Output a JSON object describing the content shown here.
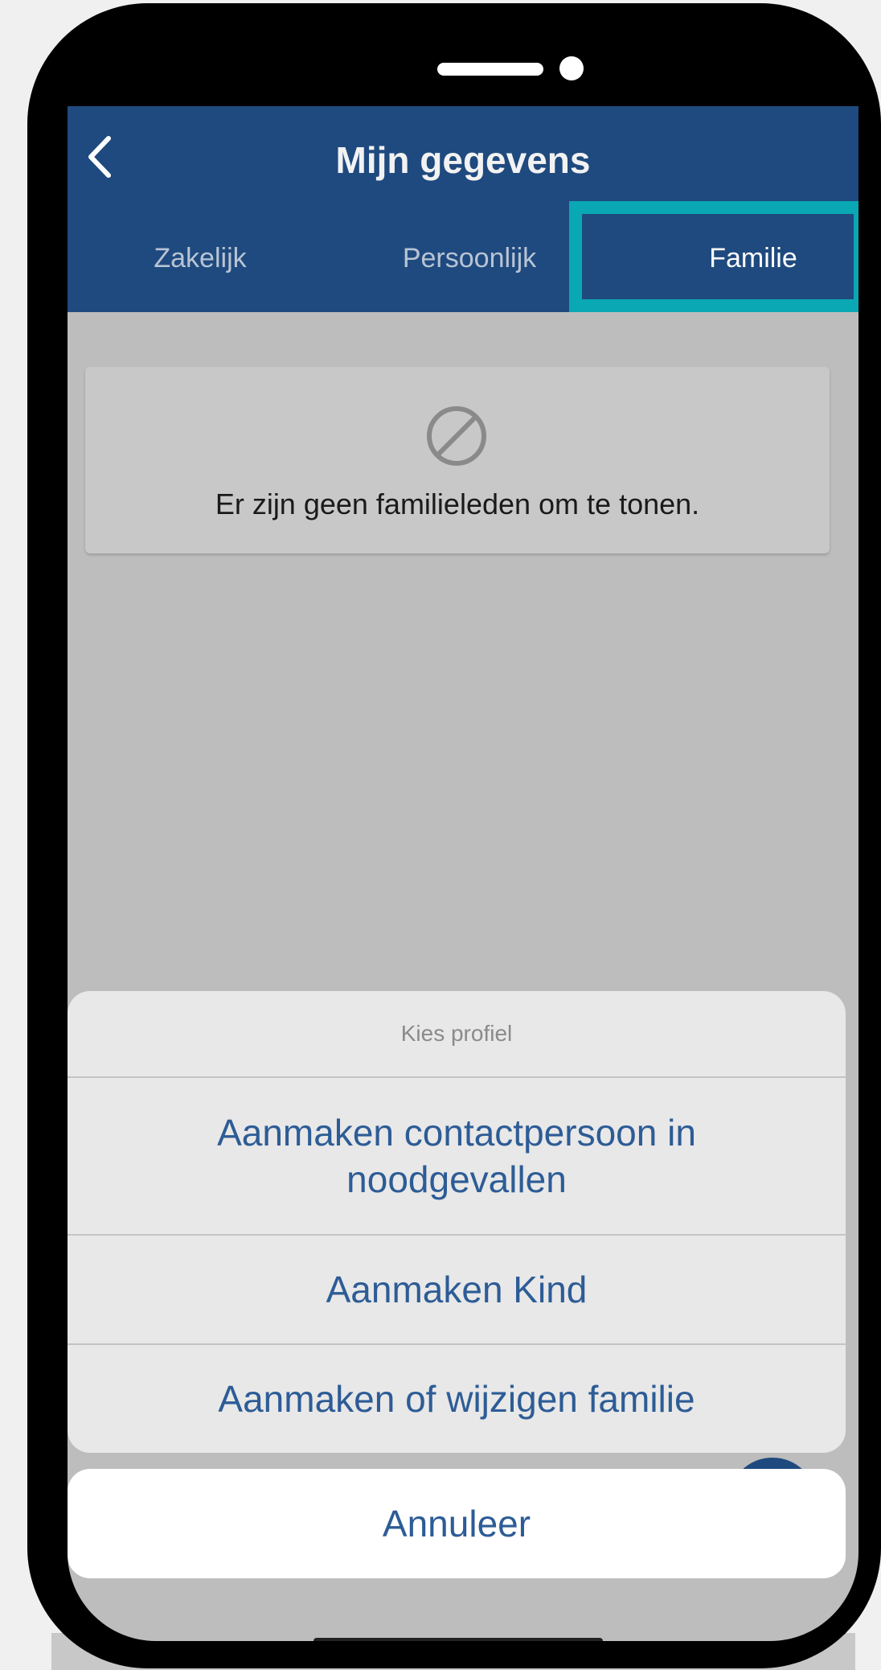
{
  "header": {
    "title": "Mijn gegevens",
    "back_icon": "chevron-left-icon"
  },
  "tabs": [
    {
      "label": "Zakelijk",
      "active": false
    },
    {
      "label": "Persoonlijk",
      "active": false
    },
    {
      "label": "Familie",
      "active": true
    }
  ],
  "highlight_color": "#0aa7b4",
  "brand_color": "#1f4a7f",
  "empty_state": {
    "icon": "ban-icon",
    "message": "Er zijn geen familieleden om te tonen."
  },
  "action_sheet": {
    "title": "Kies profiel",
    "options": [
      {
        "label": "Aanmaken contactpersoon in noodgevallen"
      },
      {
        "label": "Aanmaken Kind"
      },
      {
        "label": "Aanmaken of wijzigen familie"
      }
    ],
    "cancel_label": "Annuleer"
  }
}
